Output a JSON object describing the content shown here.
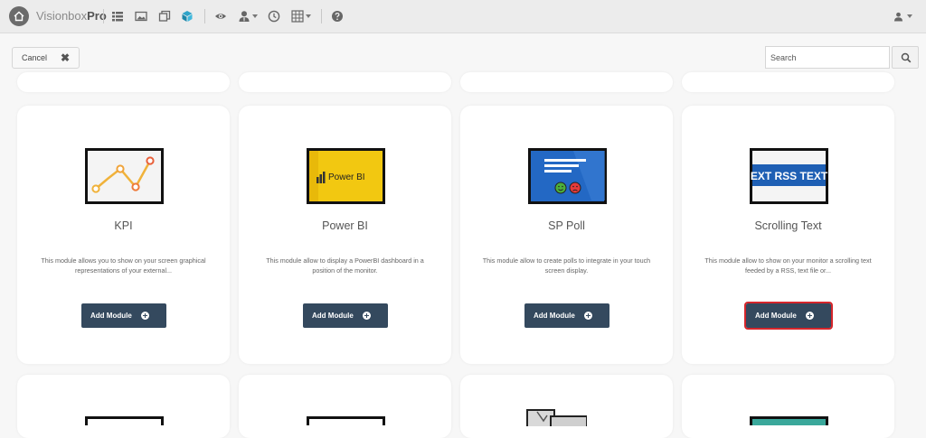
{
  "brand": {
    "name": "Visionbox",
    "suffix": "Pro"
  },
  "toolbar": {
    "cancel_label": "Cancel",
    "search_placeholder": "Search"
  },
  "cards": [
    {
      "title": "KPI",
      "description": "This module allows you to show on your screen graphical representations of your external...",
      "button_label": "Add Module",
      "thumb_label": ""
    },
    {
      "title": "Power BI",
      "description": "This module allow to display a PowerBI dashboard in a position of the monitor.",
      "button_label": "Add Module",
      "thumb_label": "Power BI"
    },
    {
      "title": "SP Poll",
      "description": "This module allow to create polls to integrate in your touch screen display.",
      "button_label": "Add Module",
      "thumb_label": ""
    },
    {
      "title": "Scrolling Text",
      "description": "This module allow to show on your monitor a scrolling text feeded by a RSS, text file or...",
      "button_label": "Add Module",
      "thumb_label": "EXT RSS TEXT"
    }
  ],
  "colors": {
    "button_bg": "#34495e",
    "highlight": "#d6262b",
    "powerbi_yellow": "#f2c811",
    "poll_blue": "#2368c4",
    "rss_blue": "#1e5fb4"
  },
  "icons": [
    "home-icon",
    "list-icon",
    "image-icon",
    "layers-icon",
    "cube-icon",
    "eye-icon",
    "user-tie-icon",
    "clock-icon",
    "grid-icon",
    "help-icon",
    "user-icon",
    "search-icon",
    "close-icon",
    "plus-circle-icon"
  ]
}
